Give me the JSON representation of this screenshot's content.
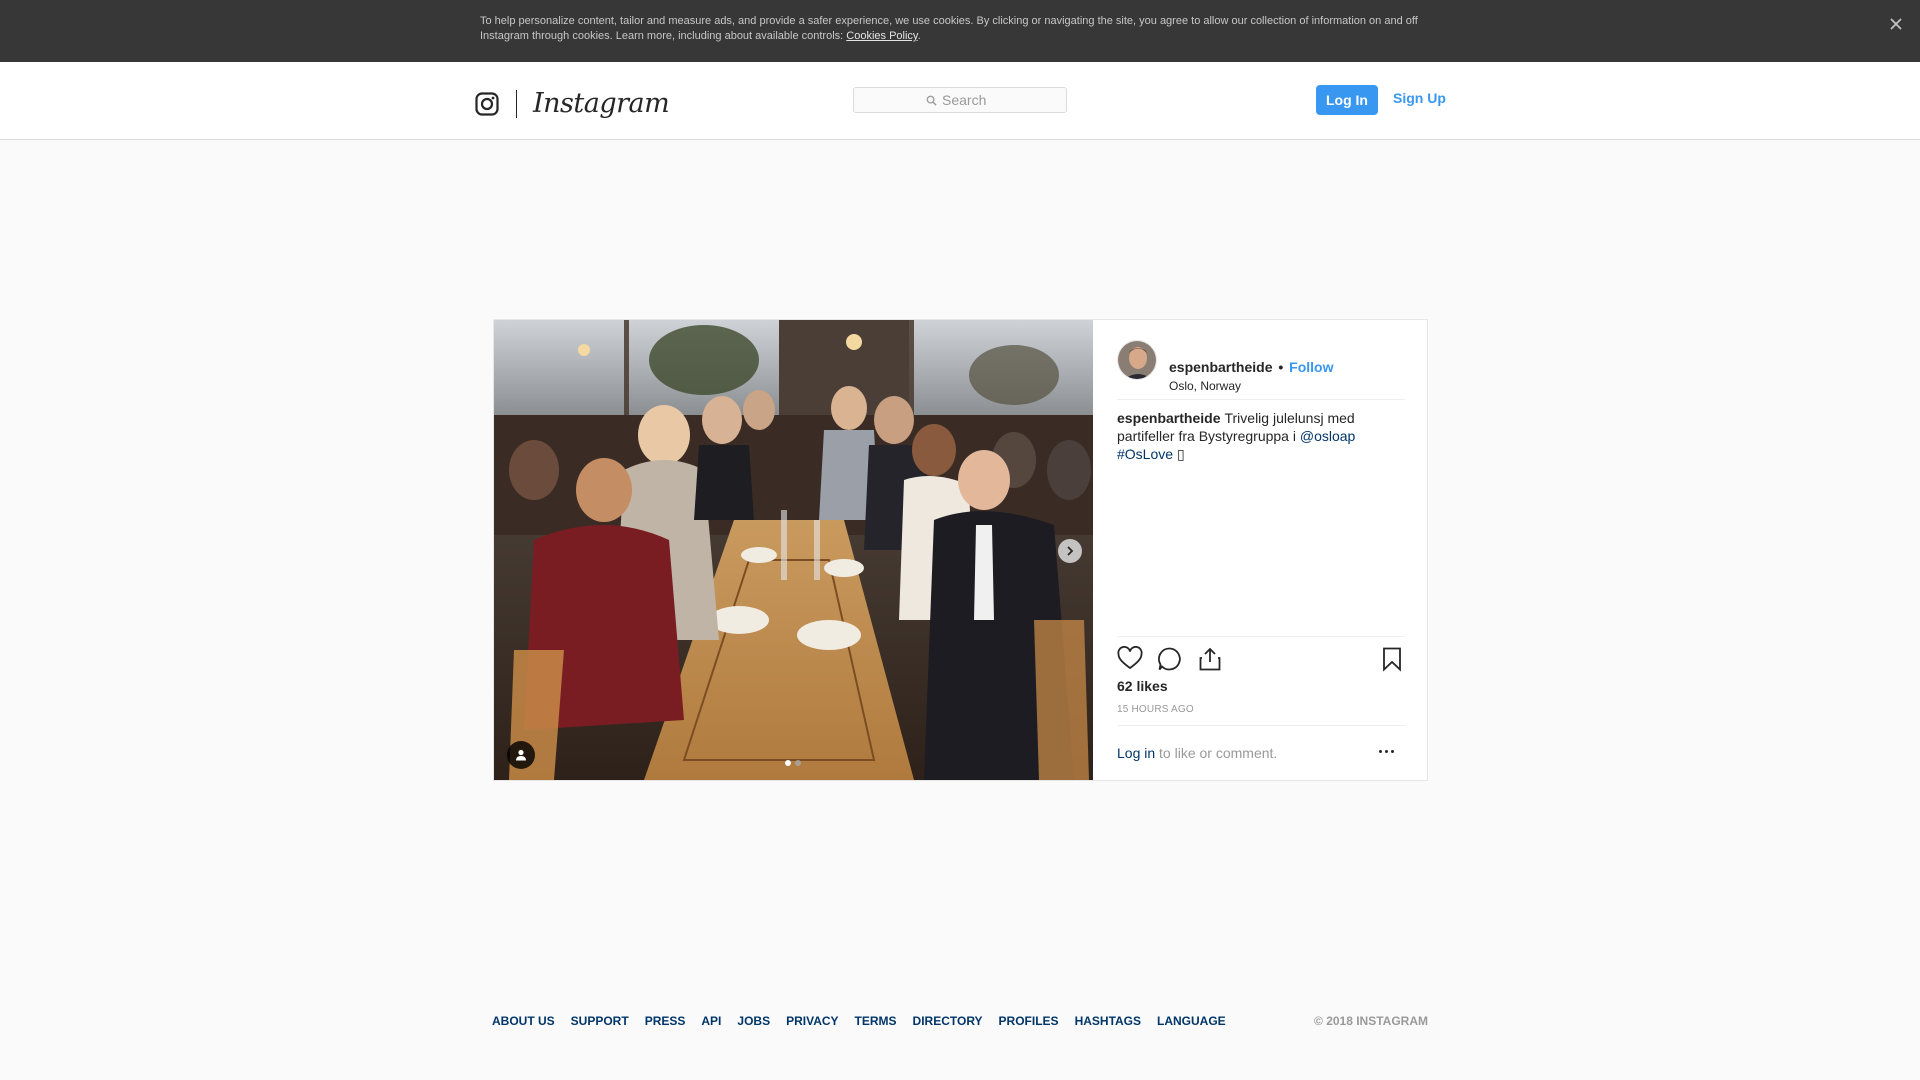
{
  "cookie_banner": {
    "text": "To help personalize content, tailor and measure ads, and provide a safer experience, we use cookies. By clicking or navigating the site, you agree to allow our collection of information on and off Instagram through cookies. Learn more, including about available controls: ",
    "link_label": "Cookies Policy",
    "period": ".",
    "close_icon": "close-icon"
  },
  "header": {
    "logo_icon": "instagram-camera-icon",
    "wordmark": "Instagram",
    "search_placeholder": "Search",
    "login_label": "Log In",
    "signup_label": "Sign Up"
  },
  "post": {
    "username": "espenbartheide",
    "bullet": "•",
    "follow_label": "Follow",
    "location": "Oslo, Norway",
    "caption": {
      "user": "espenbartheide",
      "text": "Trivelig julelunsj med partifeller fra Bystyregruppa i ",
      "mention": "@osloap",
      "hashtag": "#OsLove",
      "emoji": "▯"
    },
    "carousel": {
      "total": 2,
      "current": 1
    },
    "likes": "62 likes",
    "time": "15 HOURS AGO",
    "comment": {
      "login_label": "Log in",
      "rest": " to like or comment."
    }
  },
  "footer": {
    "links": [
      "About us",
      "Support",
      "Press",
      "API",
      "Jobs",
      "Privacy",
      "Terms",
      "Directory",
      "Profiles",
      "Hashtags",
      "Language"
    ],
    "copyright": "© 2018 Instagram"
  },
  "colors": {
    "accent": "#3897f0",
    "link_dark": "#003569",
    "banner_bg": "#373737",
    "page_bg": "#fafafa"
  }
}
